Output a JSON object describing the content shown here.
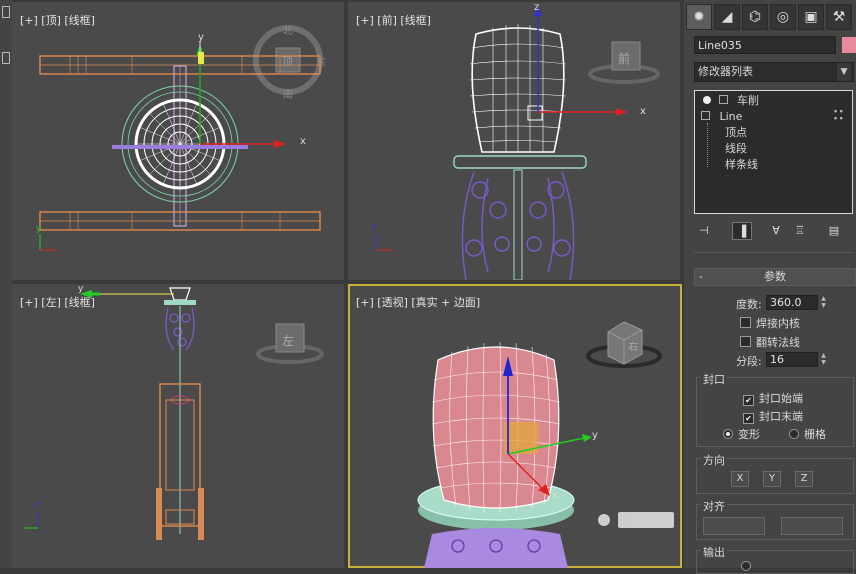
{
  "viewports": {
    "top": {
      "label": "[+] [顶] [线框]",
      "cube_face": "顶",
      "compass": {
        "n": "北",
        "e": "东",
        "s": "南"
      }
    },
    "front": {
      "label": "[+] [前] [线框]",
      "cube_face": "前"
    },
    "left": {
      "label": "[+] [左] [线框]",
      "cube_face": "左"
    },
    "perspective": {
      "label": "[+] [透视] [真实 + 边面]",
      "cube_face": "右"
    }
  },
  "axes": {
    "x": "x",
    "y": "y",
    "z": "z"
  },
  "command_panel": {
    "tabs": [
      "create-icon",
      "modify-icon",
      "hierarchy-icon",
      "motion-icon",
      "display-icon",
      "utilities-icon"
    ],
    "object_name": "Line035",
    "object_color": "#e98a9a",
    "modifier_list": "修改器列表",
    "stack": {
      "modifier": "车削",
      "base": "Line",
      "sub": [
        "顶点",
        "线段",
        "样条线"
      ]
    },
    "params": {
      "title": "参数",
      "degrees_label": "度数:",
      "degrees_value": "360.0",
      "weld_core": "焊接内核",
      "flip_normals": "翻转法线",
      "segments_label": "分段:",
      "segments_value": "16",
      "capping": {
        "title": "封口",
        "cap_start": "封口始端",
        "cap_end": "封口末端",
        "morph": "变形",
        "grid": "栅格"
      },
      "direction": {
        "title": "方向",
        "x": "X",
        "y": "Y",
        "z": "Z"
      },
      "align": {
        "title": "对齐"
      },
      "output": {
        "title": "输出"
      }
    }
  },
  "colors": {
    "viewport_bg": "#4a4a4a",
    "active_border": "#c9b037",
    "wire_white": "#ffffff",
    "wire_orange": "#e08a4c",
    "wire_purple": "#7a5acb",
    "cap_pink": "#d9888f",
    "plate_teal": "#9fd8c4"
  }
}
